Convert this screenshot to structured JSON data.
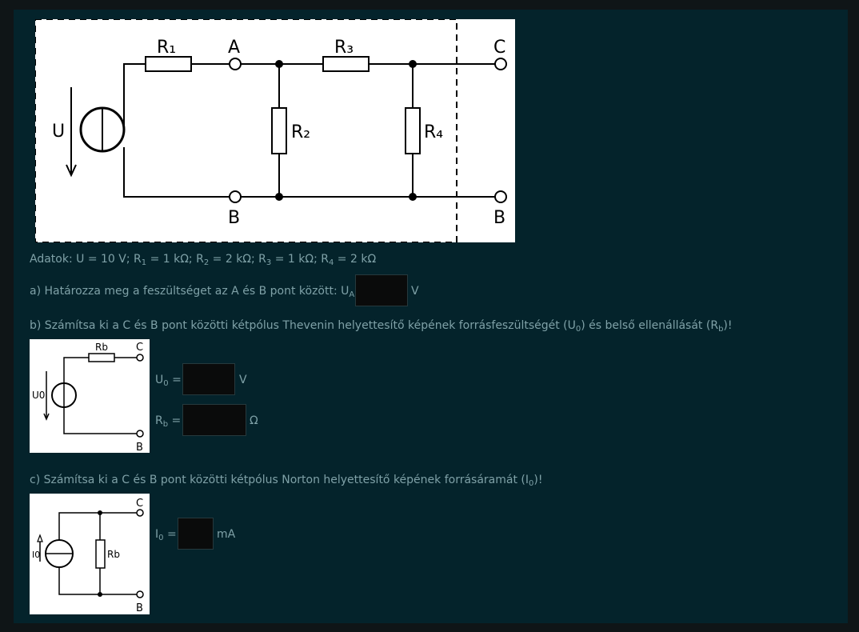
{
  "data_line": {
    "prefix": "Adatok: U = 10 V; R",
    "r1_sub": "1",
    "r1_val": " = 1 kΩ; R",
    "r2_sub": "2",
    "r2_val": " = 2 kΩ; R",
    "r3_sub": "3",
    "r3_val": " = 1 kΩ; R",
    "r4_sub": "4",
    "r4_val": " = 2 kΩ"
  },
  "question_a": {
    "text": "a) Határozza meg a feszültséget az A és B pont között: U",
    "sub": "AB",
    "eq": " =",
    "unit": "V"
  },
  "question_b": {
    "text": "b) Számítsa ki a C és B pont közötti kétpólus Thevenin helyettesítő képének forrásfeszültségét (U",
    "sub1": "0",
    "mid": ") és belső ellenállását (R",
    "sub2": "b",
    "end": ")!",
    "u0_label": "U",
    "u0_sub": "0",
    "u0_eq": " =",
    "u0_unit": "V",
    "rb_label": "R",
    "rb_sub": "b",
    "rb_eq": " =",
    "rb_unit": "Ω"
  },
  "question_c": {
    "text": "c) Számítsa ki a C és B pont közötti kétpólus Norton helyettesítő képének forrásáramát (I",
    "sub": "0",
    "end": ")!",
    "i0_label": "I",
    "i0_sub": "0",
    "i0_eq": " =",
    "i0_unit": "mA"
  },
  "main_circuit": {
    "r1": "R₁",
    "r2": "R₂",
    "r3": "R₃",
    "r4": "R₄",
    "node_a": "A",
    "node_b_left": "B",
    "node_b_right": "B",
    "node_c": "C",
    "source": "U"
  },
  "thevenin_circuit": {
    "rb": "Rb",
    "node_c": "C",
    "node_b": "B",
    "source": "U0"
  },
  "norton_circuit": {
    "rb": "Rb",
    "node_c": "C",
    "node_b": "B",
    "source": "I0"
  }
}
